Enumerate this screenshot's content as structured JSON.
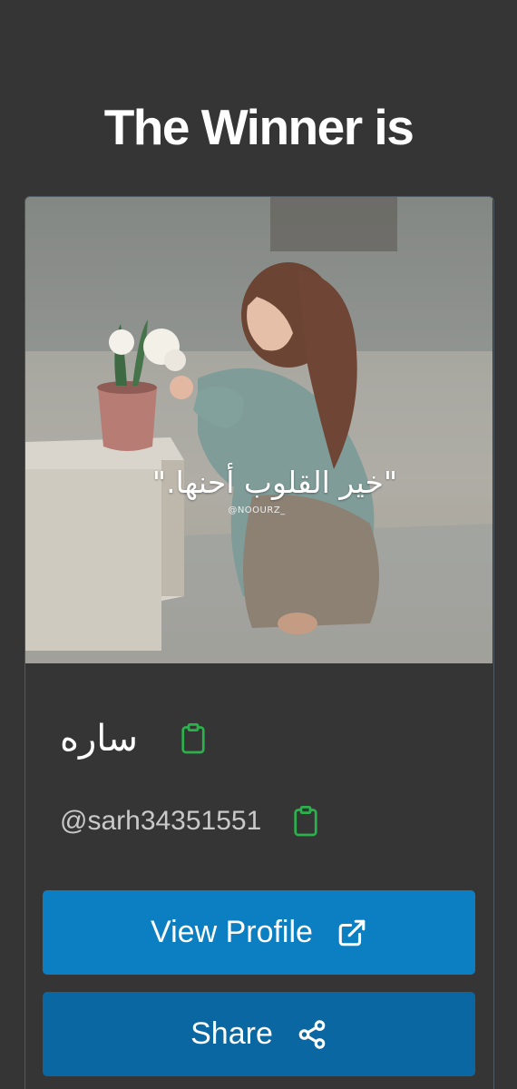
{
  "header": {
    "title": "The Winner is"
  },
  "winner": {
    "photo_caption": "\"خير القلوب أحنها.\"",
    "photo_watermark": "@NOOURZ_",
    "name": "ساره",
    "handle": "@sarh34351551"
  },
  "actions": {
    "view_profile_label": "View Profile",
    "share_label": "Share"
  },
  "colors": {
    "background": "#353535",
    "view_button": "#0b7fc1",
    "share_button": "#0a67a1",
    "copy_icon": "#2bb24c"
  },
  "icons": {
    "name_copy": "clipboard-icon",
    "handle_copy": "clipboard-icon",
    "view_profile": "external-link-icon",
    "share": "share-icon"
  }
}
